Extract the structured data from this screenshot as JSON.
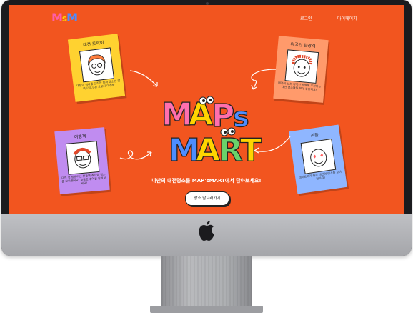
{
  "nav": {
    "logo_parts": [
      "M",
      "s",
      "M"
    ],
    "login": "로그인",
    "mypage": "마이페이지"
  },
  "cards": [
    {
      "title": "대전 토박이",
      "note": "대전의 역사를 간직한 진짜 장소만 알려드립니다! 오로지 대전을",
      "color": "#ffd230"
    },
    {
      "title": "외국인 관광객",
      "note": "대전이 낯선 외국인 분들께 추천하는 대전 명소들을 모아 놓았어요!",
      "color": "#ff9a6b"
    },
    {
      "title": "여행객",
      "note": "대전 첫 방문이신 분들께 추천할 명소를 모아봤어요! 소중한 추억을 남겨보세요!",
      "color": "#c08cf0"
    },
    {
      "title": "커플",
      "note": "데이트하기 좋은 대전의 명소를 모아놨어요!",
      "color": "#8fb6ff"
    }
  ],
  "hero": {
    "line1": [
      "M",
      "A",
      "P",
      "s"
    ],
    "line2": [
      "M",
      "A",
      "R",
      "T"
    ],
    "tagline": "나만의 대전명소를 MAP'sMART에서 담아보세요!",
    "cta": "장소 담으러가기"
  },
  "colors": {
    "background": "#f2551f",
    "bezel": "#1b1b1e"
  }
}
